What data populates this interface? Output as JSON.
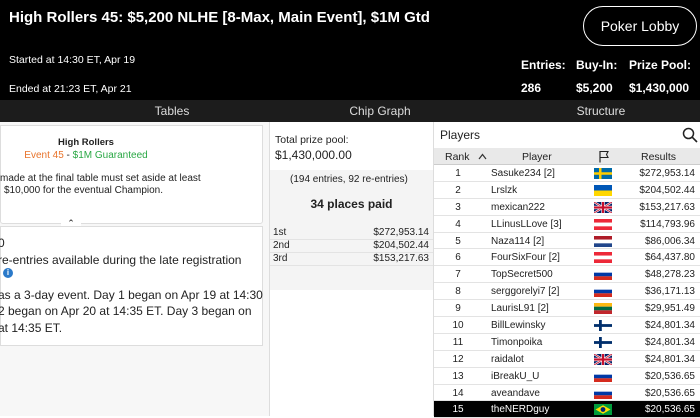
{
  "header": {
    "title": "High Rollers 45: $5,200 NLHE [8-Max, Main Event], $1M Gtd",
    "lobby_button": "Poker Lobby",
    "started": "Started at 14:30 ET, Apr 19",
    "ended": "Ended at 21:23 ET, Apr 21",
    "entries_label": "Entries:",
    "entries_value": "286",
    "buyin_label": "Buy-In:",
    "buyin_value": "$5,200",
    "pool_label": "Prize Pool:",
    "pool_value": "$1,430,000"
  },
  "tabs": [
    "Tables",
    "Chip Graph",
    "Structure"
  ],
  "promo": {
    "title": "High Rollers",
    "event": "Event 45",
    "separator": " - ",
    "guarantee": "$1M Guaranteed",
    "text1": "made at the final table must set aside at least",
    "text2": "$10,000 for the eventual Champion."
  },
  "info": {
    "line1": "0",
    "line2": "re-entries available during the late registration",
    "line3": "as a 3-day event. Day 1 began on Apr 19 at 14:30",
    "line4": "2 began on Apr 20 at 14:35 ET. Day 3 began on",
    "line5": "at 14:35 ET.",
    "info_icon": "i"
  },
  "prizes": {
    "total_label": "Total prize pool:",
    "total_value": "$1,430,000.00",
    "entries_note": "(194 entries, 92 re-entries)",
    "places_paid": "34 places paid",
    "rows": [
      {
        "place": "1st",
        "amount": "$272,953.14"
      },
      {
        "place": "2nd",
        "amount": "$204,502.44"
      },
      {
        "place": "3rd",
        "amount": "$153,217.63"
      }
    ]
  },
  "players": {
    "title": "Players",
    "col_rank": "Rank",
    "col_player": "Player",
    "col_results": "Results",
    "rows": [
      {
        "rank": "1",
        "name": "Sasuke234 [2]",
        "flag": "sweden",
        "result": "$272,953.14"
      },
      {
        "rank": "2",
        "name": "Lrslzk",
        "flag": "ukraine",
        "result": "$204,502.44"
      },
      {
        "rank": "3",
        "name": "mexican222",
        "flag": "uk",
        "result": "$153,217.63"
      },
      {
        "rank": "4",
        "name": "LLinusLLove [3]",
        "flag": "austria",
        "result": "$114,793.96"
      },
      {
        "rank": "5",
        "name": "Naza114 [2]",
        "flag": "netherlands",
        "result": "$86,006.34"
      },
      {
        "rank": "6",
        "name": "FourSixFour [2]",
        "flag": "austria",
        "result": "$64,437.80"
      },
      {
        "rank": "7",
        "name": "TopSecret500",
        "flag": "russia",
        "result": "$48,278.23"
      },
      {
        "rank": "8",
        "name": "serggorelyi7 [2]",
        "flag": "russia",
        "result": "$36,171.13"
      },
      {
        "rank": "9",
        "name": "LaurisL91 [2]",
        "flag": "lithuania",
        "result": "$29,951.49"
      },
      {
        "rank": "10",
        "name": "BillLewinsky",
        "flag": "finland",
        "result": "$24,801.34"
      },
      {
        "rank": "11",
        "name": "Timonpoika",
        "flag": "finland",
        "result": "$24,801.34"
      },
      {
        "rank": "12",
        "name": "raidalot",
        "flag": "uk",
        "result": "$24,801.34"
      },
      {
        "rank": "13",
        "name": "iBreakU_U",
        "flag": "russia",
        "result": "$20,536.65"
      },
      {
        "rank": "14",
        "name": "aveandave",
        "flag": "russia",
        "result": "$20,536.65"
      },
      {
        "rank": "15",
        "name": "theNERDguy",
        "flag": "brazil",
        "result": "$20,536.65"
      }
    ],
    "selected_index": 14
  },
  "colors": {
    "event": "#e8742c",
    "guarantee": "#2aa845",
    "header_bg": "#000000",
    "tabs_bg": "#1c1c1c"
  }
}
